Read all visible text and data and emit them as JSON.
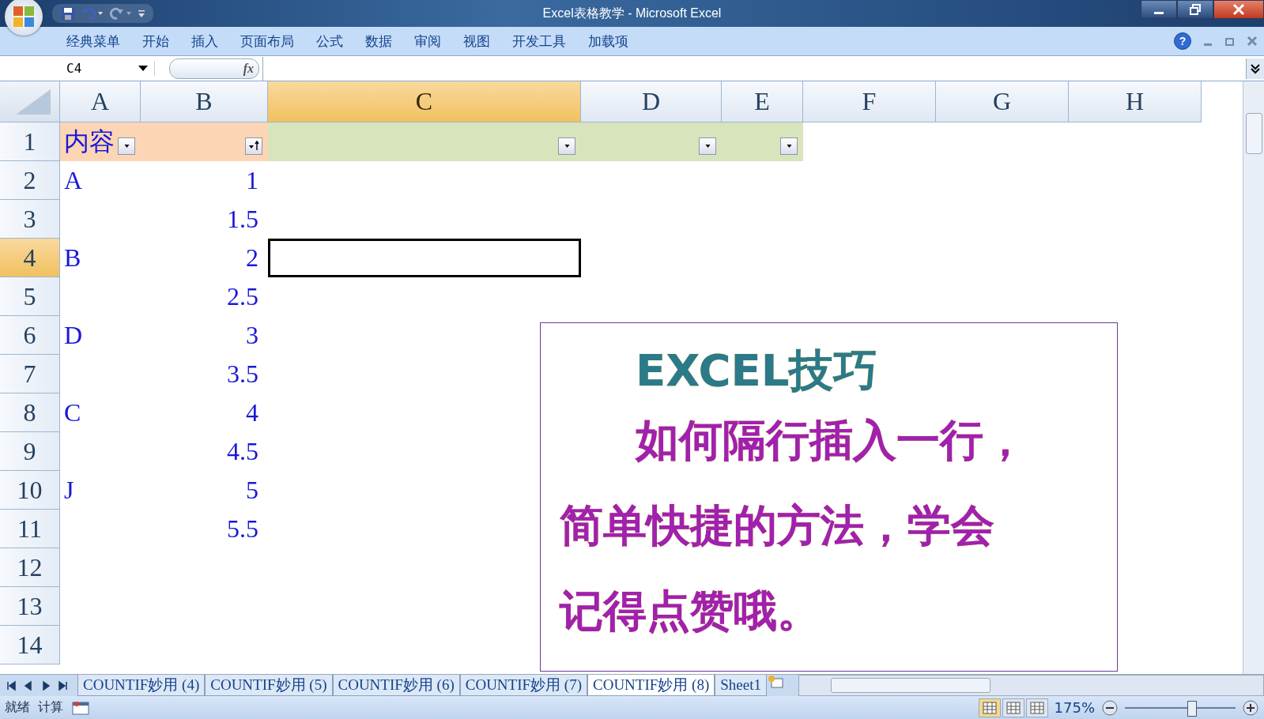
{
  "window": {
    "title": "Excel表格教学 - Microsoft Excel"
  },
  "ribbon_tabs": [
    {
      "label": "经典菜单"
    },
    {
      "label": "开始"
    },
    {
      "label": "插入"
    },
    {
      "label": "页面布局"
    },
    {
      "label": "公式"
    },
    {
      "label": "数据"
    },
    {
      "label": "审阅"
    },
    {
      "label": "视图"
    },
    {
      "label": "开发工具"
    },
    {
      "label": "加载项"
    }
  ],
  "help_button": {
    "label": "?"
  },
  "name_box": "C4",
  "function_button": {
    "label": "fx"
  },
  "columns": [
    {
      "label": "A",
      "selected": false
    },
    {
      "label": "B",
      "selected": false
    },
    {
      "label": "C",
      "selected": true
    },
    {
      "label": "D",
      "selected": false
    },
    {
      "label": "E",
      "selected": false
    },
    {
      "label": "F",
      "selected": false
    },
    {
      "label": "G",
      "selected": false
    },
    {
      "label": "H",
      "selected": false
    }
  ],
  "header_row": {
    "number": "1",
    "selected": false,
    "cells": [
      {
        "text": "内容",
        "color": "#fcd5b4",
        "filter": true,
        "sorted": false
      },
      {
        "color": "#fcd5b4",
        "filter": true,
        "sorted": true
      },
      {
        "color": "#d8e4bc",
        "filter": true,
        "sorted": false
      },
      {
        "color": "#d8e4bc",
        "filter": true,
        "sorted": false
      },
      {
        "color": "#d8e4bc",
        "filter": true,
        "sorted": false
      }
    ]
  },
  "rows": [
    {
      "number": "2",
      "selected": false,
      "a": "A",
      "b": "1"
    },
    {
      "number": "3",
      "selected": false,
      "b": "1.5"
    },
    {
      "number": "4",
      "selected": true,
      "a": "B",
      "b": "2"
    },
    {
      "number": "5",
      "selected": false,
      "b": "2.5"
    },
    {
      "number": "6",
      "selected": false,
      "a": "D",
      "b": "3"
    },
    {
      "number": "7",
      "selected": false,
      "b": "3.5"
    },
    {
      "number": "8",
      "selected": false,
      "a": "C",
      "b": "4"
    },
    {
      "number": "9",
      "selected": false,
      "b": "4.5"
    },
    {
      "number": "10",
      "selected": false,
      "a": "J",
      "b": "5"
    },
    {
      "number": "11",
      "selected": false,
      "b": "5.5"
    },
    {
      "number": "12",
      "selected": false
    },
    {
      "number": "13",
      "selected": false
    },
    {
      "number": "14",
      "selected": false
    }
  ],
  "text_box": {
    "title": "EXCEL技巧",
    "lines": [
      "如何隔行插入一行，",
      "简单快捷的方法，学会",
      "记得点赞哦。"
    ]
  },
  "sheet_tabs": [
    {
      "label": "COUNTIF妙用 (4)",
      "selected": false
    },
    {
      "label": "COUNTIF妙用 (5)",
      "selected": false
    },
    {
      "label": "COUNTIF妙用 (6)",
      "selected": false
    },
    {
      "label": "COUNTIF妙用 (7)",
      "selected": false
    },
    {
      "label": "COUNTIF妙用 (8)",
      "selected": true
    },
    {
      "label": "Sheet1",
      "selected": false
    }
  ],
  "status_bar": {
    "items": [
      "就绪",
      "计算"
    ],
    "zoom": "175%",
    "zoom_level": {
      "level": 0.6
    },
    "views": [
      {
        "selected": true
      },
      {
        "selected": false
      },
      {
        "selected": false
      }
    ]
  }
}
